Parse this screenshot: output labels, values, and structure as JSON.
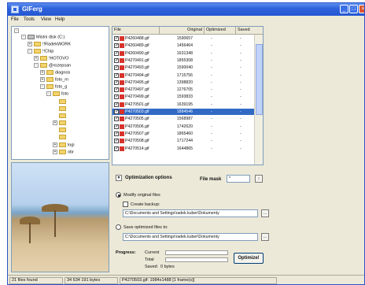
{
  "window": {
    "title": "GIFerg"
  },
  "menu": [
    "File",
    "Tools",
    "View",
    "Help"
  ],
  "tree": [
    {
      "label": "",
      "kind": "root"
    },
    {
      "label": "Mistni disk (C:)",
      "kind": "drive"
    },
    {
      "label": "!!RadekWORK",
      "kind": "folder"
    },
    {
      "label": "!!Chip",
      "kind": "folder"
    },
    {
      "label": "!HOTOVO",
      "kind": "folder"
    },
    {
      "label": "@rozepsan",
      "kind": "folder"
    },
    {
      "label": "diagnos",
      "kind": "folder"
    },
    {
      "label": "foto_m",
      "kind": "folder"
    },
    {
      "label": "foto_g",
      "kind": "folder"
    },
    {
      "label": "foto",
      "kind": "folder"
    },
    {
      "label": "",
      "kind": "folder"
    },
    {
      "label": "",
      "kind": "folder"
    },
    {
      "label": "",
      "kind": "folder"
    },
    {
      "label": "",
      "kind": "folder"
    },
    {
      "label": "",
      "kind": "folder"
    },
    {
      "label": "",
      "kind": "folder"
    },
    {
      "label": "logi",
      "kind": "folder"
    },
    {
      "label": "obr",
      "kind": "folder"
    }
  ],
  "files": {
    "columns": [
      "File",
      "Original",
      "Optimized",
      "Saved"
    ],
    "rows": [
      {
        "name": "P4260488.gif",
        "original": "1590657",
        "optimized": "-",
        "saved": "-"
      },
      {
        "name": "P4260489.gif",
        "original": "1456464",
        "optimized": "-",
        "saved": "-"
      },
      {
        "name": "P4260490.gif",
        "original": "1631348",
        "optimized": "-",
        "saved": "-"
      },
      {
        "name": "P4270491.gif",
        "original": "1855308",
        "optimized": "-",
        "saved": "-"
      },
      {
        "name": "P4270493.gif",
        "original": "1590040",
        "optimized": "-",
        "saved": "-"
      },
      {
        "name": "P4270494.gif",
        "original": "1715756",
        "optimized": "-",
        "saved": "-"
      },
      {
        "name": "P4270495.gif",
        "original": "1398820",
        "optimized": "-",
        "saved": "-"
      },
      {
        "name": "P4270497.gif",
        "original": "1276705",
        "optimized": "-",
        "saved": "-"
      },
      {
        "name": "P4270499.gif",
        "original": "1593833",
        "optimized": "-",
        "saved": "-"
      },
      {
        "name": "P4270501.gif",
        "original": "1639195",
        "optimized": "-",
        "saved": "-"
      },
      {
        "name": "P4270503.gif",
        "original": "1884546",
        "optimized": "-",
        "saved": "-"
      },
      {
        "name": "P4270505.gif",
        "original": "1568987",
        "optimized": "-",
        "saved": "-"
      },
      {
        "name": "P4270506.gif",
        "original": "1742620",
        "optimized": "-",
        "saved": "-"
      },
      {
        "name": "P4270507.gif",
        "original": "1865460",
        "optimized": "-",
        "saved": "-"
      },
      {
        "name": "P4270508.gif",
        "original": "1717244",
        "optimized": "-",
        "saved": "-"
      },
      {
        "name": "P4270514.gif",
        "original": "1644865",
        "optimized": "-",
        "saved": "-"
      }
    ],
    "selected_index": 10
  },
  "options": {
    "header": "Optimization options",
    "mask_label": "File mask",
    "mask_value": "*",
    "modify_label": "Modify original files",
    "backup_label": "Create backup:",
    "backup_path": "C:\\Documents and Settings\\radek.kuber\\Dokumenty",
    "save_label": "Save optimized files to:",
    "save_path": "C:\\Documents and Settings\\radek.kuber\\Dokumenty",
    "browse": "..."
  },
  "progress": {
    "label": "Progress:",
    "current": "Current",
    "total": "Total",
    "saved": "Saved:",
    "saved_value": "0 bytes"
  },
  "optimize_button": "Optimize!",
  "status": {
    "files": "21 files found",
    "bytes": "34 634 191 bytes",
    "current": "P4270503.gif: 1984x1488 [1 frame(s)]"
  },
  "colors": {
    "titlebar": "#2f64dc",
    "selection": "#316ac5",
    "window_bg": "#ece9d8"
  }
}
